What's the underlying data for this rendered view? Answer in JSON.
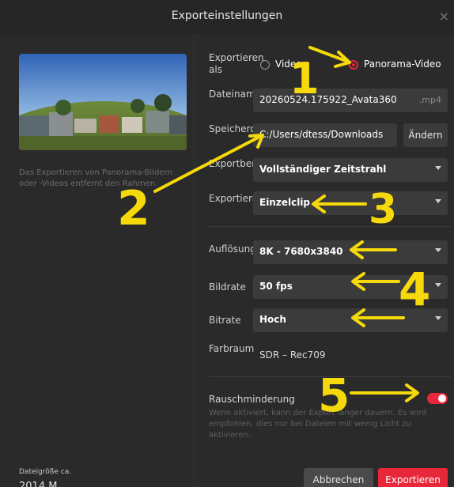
{
  "window": {
    "title": "Exporteinstellungen"
  },
  "left": {
    "note": "Das Exportieren von Panorama-Bildern oder -Videos entfernt den Rahmen.",
    "file_size_label": "Dateigröße ca.",
    "file_size_value": "2014 M"
  },
  "export_as": {
    "label": "Exportieren als",
    "options": [
      "Videos",
      "Panorama-Video"
    ],
    "selected": "Panorama-Video"
  },
  "filename": {
    "label": "Dateiname",
    "value": "20260524.175922_Avata360",
    "ext": ".mp4"
  },
  "location": {
    "label": "Speicherort",
    "value": "C:/Users/dtess/Downloads",
    "change_label": "Ändern"
  },
  "range": {
    "label": "Exportbereich",
    "value": "Vollständiger Zeitstrahl"
  },
  "method": {
    "label": "Exportiermeth...",
    "value": "Einzelclip"
  },
  "resolution": {
    "label": "Auflösung",
    "value": "8K - 7680x3840"
  },
  "framerate": {
    "label": "Bildrate",
    "value": "50 fps"
  },
  "bitrate": {
    "label": "Bitrate",
    "value": "Hoch"
  },
  "colorspace": {
    "label": "Farbraum",
    "value": "SDR – Rec709"
  },
  "noise": {
    "label": "Rauschminderung",
    "enabled": true,
    "desc": "Wenn aktiviert, kann der Export länger dauern. Es wird empfohlen, dies nur bei Dateien mit wenig Licht zu aktivieren."
  },
  "buttons": {
    "cancel": "Abbrechen",
    "export": "Exportieren"
  },
  "annotations": {
    "n1": "1",
    "n2": "2",
    "n3": "3",
    "n4": "4",
    "n5": "5"
  },
  "colors": {
    "accent": "#e8283a",
    "annotation": "#f5d90a",
    "background": "#2a2a2a"
  }
}
